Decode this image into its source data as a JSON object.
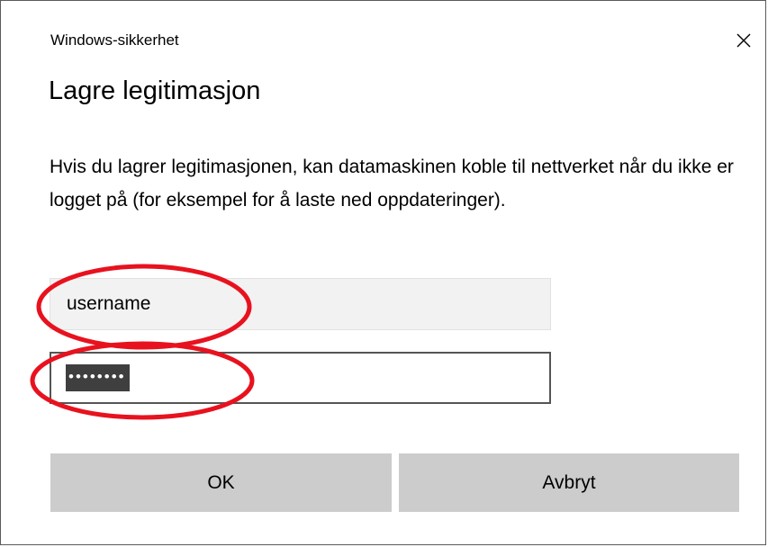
{
  "window": {
    "title": "Windows-sikkerhet",
    "close_icon": "close-icon"
  },
  "dialog": {
    "heading": "Lagre legitimasjon",
    "description": "Hvis du lagrer legitimasjonen, kan datamaskinen koble til nettverket når du ikke er logget på (for eksempel for å laste ned oppdateringer)."
  },
  "fields": {
    "username_value": "username",
    "password_masked": "••••••••"
  },
  "buttons": {
    "ok_label": "OK",
    "cancel_label": "Avbryt"
  },
  "colors": {
    "button_bg": "#cccccc",
    "field_bg": "#f2f2f2",
    "annotation": "#e8121f"
  }
}
